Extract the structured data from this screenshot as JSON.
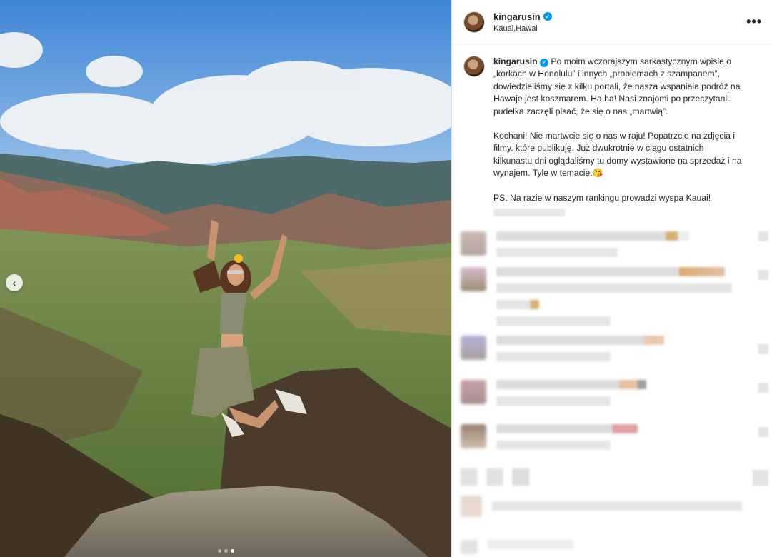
{
  "post": {
    "username": "kingarusin",
    "location": "Kauai,Hawai",
    "more_icon": "•••",
    "verified_glyph": "✓"
  },
  "caption": {
    "username": "kingarusin",
    "p1": "Po moim wczorajszym sarkastycznym wpisie o „korkach w Honolulu” i innych „problemach z szampanem”, dowiedzieliśmy się z kilku portali, że nasza wspaniała podróż na Hawaje jest koszmarem. Ha ha! Nasi znajomi po przeczytaniu pudelka zaczęli pisać, że się o nas „martwią”.",
    "p2": "Kochani! Nie martwcie się o nas w raju! Popatrzcie na zdjęcia i filmy, które publikuję. Już dwukrotnie w ciągu ostatnich kilkunastu dni oglądaliśmy tu domy wystawione na sprzedaż i na wynajem. Tyle w temacie.😘",
    "p3": "PS. Na razie w naszym rankingu prowadzi wyspa Kauai!"
  },
  "carousel": {
    "prev_glyph": "‹",
    "slide_count": 3,
    "active_slide": 3
  },
  "colors": {
    "accent": "#0095f6",
    "border": "#dbdbdb"
  }
}
